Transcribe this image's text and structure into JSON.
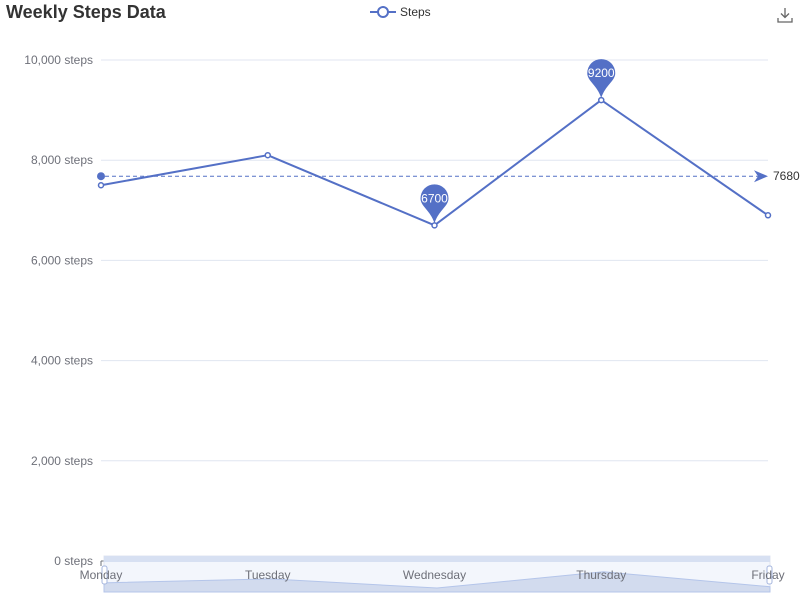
{
  "chart_data": {
    "type": "line",
    "title": "Weekly Steps Data",
    "categories": [
      "Monday",
      "Tuesday",
      "Wednesday",
      "Thursday",
      "Friday"
    ],
    "series": [
      {
        "name": "Steps",
        "values": [
          7500,
          8100,
          6700,
          9200,
          6900
        ]
      }
    ],
    "y_tick_labels": [
      "0 steps",
      "2,000 steps",
      "4,000 steps",
      "6,000 steps",
      "8,000 steps",
      "10,000 steps"
    ],
    "y_ticks": [
      0,
      2000,
      4000,
      6000,
      8000,
      10000
    ],
    "ylim": [
      0,
      10000
    ],
    "grid": true,
    "legend_position": "top-center",
    "mark_points": [
      {
        "category": "Wednesday",
        "value": 6700,
        "label": "6700",
        "kind": "min"
      },
      {
        "category": "Thursday",
        "value": 9200,
        "label": "9200",
        "kind": "max"
      }
    ],
    "mark_line": {
      "value": 7680,
      "label": "7680",
      "kind": "average"
    },
    "data_zoom": {
      "start_fraction": 0,
      "end_fraction": 1
    },
    "colors": {
      "series": "#5470c6",
      "grid": "#e0e6f1",
      "axis_text": "#6e7079",
      "zoom_fill": "#d2dbee"
    }
  },
  "toolbox": {
    "download_icon": "download-icon"
  }
}
